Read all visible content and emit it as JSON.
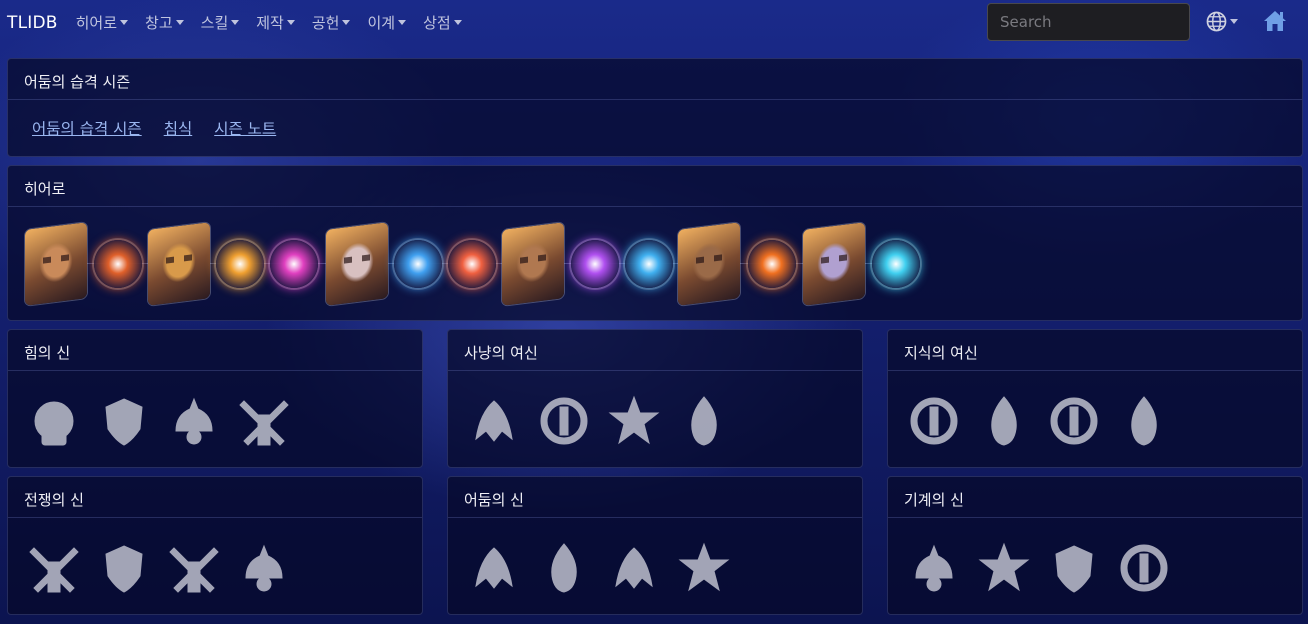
{
  "nav": {
    "brand": "TLIDB",
    "items": [
      {
        "label": "히어로"
      },
      {
        "label": "창고"
      },
      {
        "label": "스킬"
      },
      {
        "label": "제작"
      },
      {
        "label": "공헌"
      },
      {
        "label": "이계"
      },
      {
        "label": "상점"
      }
    ],
    "search_placeholder": "Search",
    "icons": [
      "globe-icon",
      "home-icon"
    ]
  },
  "season": {
    "title": "어둠의 습격 시즌",
    "links": [
      "어둠의 습격 시즌",
      "침식",
      "시즌 노트"
    ]
  },
  "heroes": {
    "title": "히어로",
    "portrait_colors": [
      "#c98a5a",
      "#d89a4a",
      "#d8c0c0",
      "#b07850",
      "#9a6a48",
      "#b0a0d0"
    ],
    "talent_colors": [
      "#e0602a",
      "#f0a030",
      "#e040c0",
      "#40a0f0",
      "#f06040",
      "#b050f0",
      "#40b0f0",
      "#f07020",
      "#40d0f0"
    ]
  },
  "gods": [
    {
      "title": "힘의 신"
    },
    {
      "title": "사냥의 여신"
    },
    {
      "title": "지식의 여신"
    },
    {
      "title": "전쟁의 신"
    },
    {
      "title": "어둠의 신"
    },
    {
      "title": "기계의 신"
    }
  ],
  "colors": {
    "link": "#9ab6f0",
    "home_icon": "#6f9fe6",
    "emblem": "#b8bac8"
  }
}
